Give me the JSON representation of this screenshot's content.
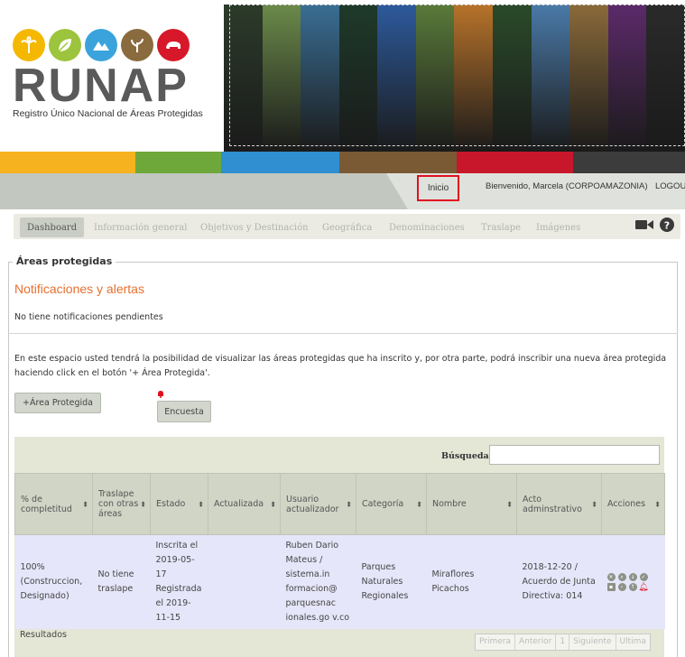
{
  "logo": {
    "word": "RUNAP",
    "subtitle": "Registro Único Nacional de Áreas Protegidas",
    "circle_colors": [
      "#f5b800",
      "#9cc43c",
      "#3aa3dc",
      "#8a6b3e",
      "#d7182a"
    ]
  },
  "header": {
    "strip_colors": [
      "#f6b21f",
      "#6fa83a",
      "#2f8fd0",
      "#7a5a34",
      "#c8162a",
      "#3c3c3c"
    ],
    "photo_colors": [
      "#2c3b2a",
      "#6b8a4a",
      "#3a6e94",
      "#1e3a2a",
      "#2d5a9c",
      "#5a7a3a",
      "#b8732a",
      "#2a4a2a",
      "#4a7aa8",
      "#8a6a3a",
      "#5c2a6a",
      "#2a2a2a"
    ]
  },
  "userbar": {
    "inicio": "Inicio",
    "welcome": "Bienvenido, Marcela (CORPOAMAZONIA)",
    "logout": "LOGOUT"
  },
  "nav": {
    "tabs": [
      "Dashboard",
      "Información general",
      "Objetivos y Destinación",
      "Geográfica",
      "Denominaciones",
      "Traslape",
      "Imágenes"
    ],
    "icons": [
      "video-camera-icon",
      "help-icon"
    ]
  },
  "main": {
    "legend": "Áreas protegidas",
    "notif_title": "Notificaciones y alertas",
    "notif_text": "No tiene notificaciones pendientes",
    "intro": "En este espacio usted tendrá la posibilidad de visualizar las áreas protegidas que ha inscrito y, por otra parte, podrá inscribir una nueva área protegida haciendo click en el botón '+ Área Protegida'.",
    "add_button": "+Área Protegida",
    "survey_button": "Encuesta"
  },
  "table": {
    "search_label": "Búsqueda:",
    "search_value": "",
    "headers": [
      "% de completitud",
      "Traslape con otras áreas",
      "Estado",
      "Actualizada",
      "Usuario actualizador",
      "Categoría",
      "Nombre",
      "Acto adminstrativo",
      "Acciones"
    ],
    "rows": [
      [
        "100% (Construccion, Designado)",
        "No tiene traslape",
        "Inscrita el 2019-05-17 Registrada el 2019-11-15",
        "",
        "Ruben Dario Mateus / sistema.in formacion@ parquesnac ionales.go v.co",
        "Parques Naturales Regionales",
        "Miraflores Picachos",
        "2018-12-20 / Acuerdo de Junta Directiva: 014",
        ""
      ]
    ],
    "results_label": "Resultados",
    "pager": [
      "Primera",
      "Anterior",
      "1",
      "Siguiente",
      "Ultima"
    ]
  },
  "colors": {
    "accent_orange": "#e6702e",
    "highlight_red": "#e01020",
    "row_bg": "#e6e6fa"
  }
}
